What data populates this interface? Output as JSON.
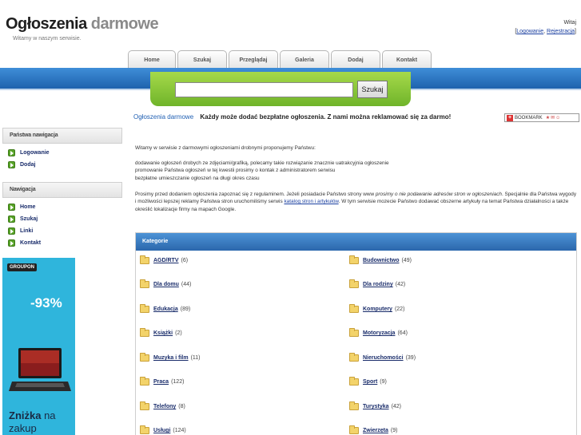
{
  "header": {
    "logo_part1": "Ogłoszenia",
    "logo_part2": "darmowe",
    "tagline": "Witamy w naszym serwisie.",
    "greeting": "Witaj",
    "login_link": "Logowanie",
    "separator": ", ",
    "register_link": "Rejestracja",
    "bracket_open": "[",
    "bracket_close": "]"
  },
  "nav": {
    "tabs": [
      "Home",
      "Szukaj",
      "Przeglądaj",
      "Galeria",
      "Dodaj",
      "Kontakt"
    ]
  },
  "search": {
    "value": "",
    "button_label": "Szukaj"
  },
  "sidebar": {
    "block1_title": "Państwa nawigacja",
    "block1_items": [
      "Logowanie",
      "Dodaj"
    ],
    "block2_title": "Nawigacja",
    "block2_items": [
      "Home",
      "Szukaj",
      "Linki",
      "Kontakt"
    ]
  },
  "banner": {
    "brand": "GROUPON",
    "discount": "-93%",
    "line1_bold": "Zniżka",
    "line1_rest": " na",
    "line2": "zakup"
  },
  "main": {
    "crumb_link": "Ogłoszenia darmowe",
    "crumb_text": "Każdy może dodać bezpłatne ogłoszenia.  Z nami można reklamować się za darmo!",
    "bookmark_label": "BOOKMARK",
    "intro": "Witamy w serwisie z darmowymi ogłoszeniami drobnymi proponujemy Państwu:",
    "list_line1": "dodawanie ogłoszeń drobych ze zdjęciami/grafiką, polecamy takie rozwiązanie znacznie uatrakcyjnia ogłoszenie",
    "list_line2": "promowanie Państwa ogłoszeń w tej kwestii prosimy o kontak z administratorem serwisu",
    "list_line3": "bezpłatne umieszczanie ogłoszeń na długi okres czasu",
    "para_a": "Prosimy przed dodaniem ogłoszenia zapoznać się z regulaminem. Jeżeli posiadacie Państwo strony www ",
    "para_italic": "prosimy o nie podawanie adresów stron w ogłoszeniach",
    "para_b": ". Specjalnie dla Państwa wygody i możliwości lepszej reklamy Państwa stron uruchomiliśmy serwis ",
    "para_link": "katalog stron i artykułów",
    "para_c": ". W tym serwisie mozecie Państwo dodawać obszerne artykuły na temat Państwa działalności a także określić lokalizacje  firmy na mapach Google."
  },
  "categories": {
    "title": "Kategorie",
    "left": [
      {
        "name": "AGD/RTV",
        "count": "(6)"
      },
      {
        "name": "Dla domu",
        "count": "(44)"
      },
      {
        "name": "Edukacja",
        "count": "(89)"
      },
      {
        "name": "Książki",
        "count": "(2)"
      },
      {
        "name": "Muzyka i film",
        "count": "(11)"
      },
      {
        "name": "Praca",
        "count": "(122)"
      },
      {
        "name": "Telefony",
        "count": "(8)"
      },
      {
        "name": "Usługi",
        "count": "(124)"
      }
    ],
    "right": [
      {
        "name": "Budownictwo",
        "count": "(49)"
      },
      {
        "name": "Dla rodziny",
        "count": "(42)"
      },
      {
        "name": "Komputery",
        "count": "(22)"
      },
      {
        "name": "Motoryzacja",
        "count": "(64)"
      },
      {
        "name": "Nieruchomości",
        "count": "(39)"
      },
      {
        "name": "Sport",
        "count": "(9)"
      },
      {
        "name": "Turystyka",
        "count": "(42)"
      },
      {
        "name": "Zwierzęta",
        "count": "(9)"
      }
    ]
  }
}
